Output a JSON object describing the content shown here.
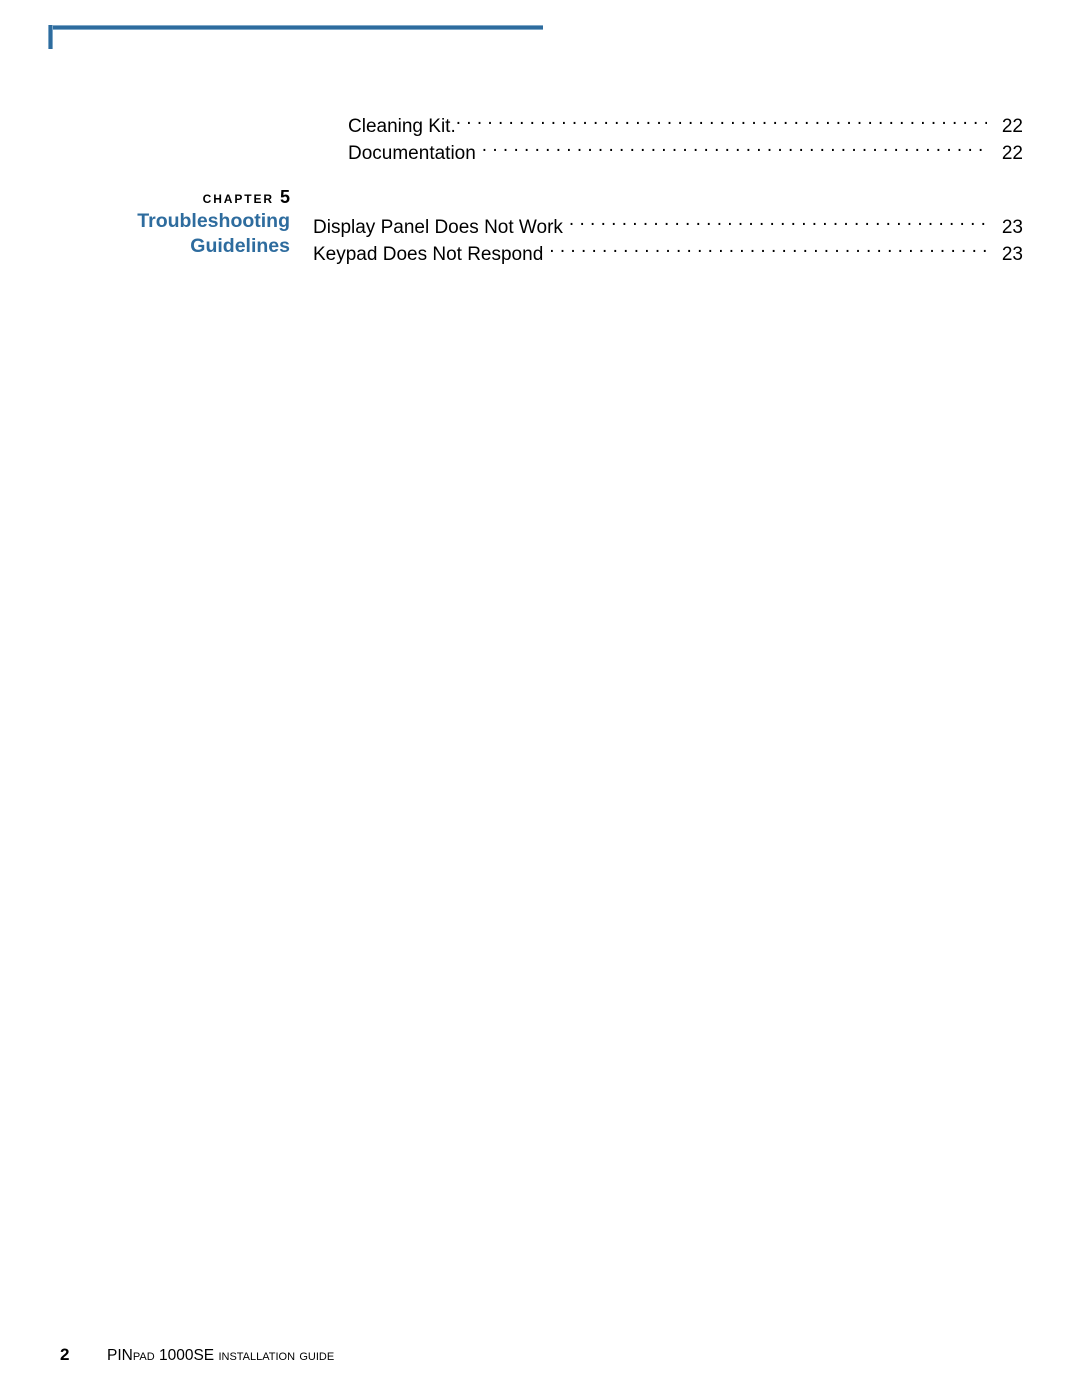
{
  "page": {
    "background_color": "#ffffff",
    "rule_color": "#2E6C9E",
    "accent_color": "#2E6C9E"
  },
  "chapter": {
    "kicker_label": "Chapter",
    "number": "5",
    "title_line_1": "Troubleshooting",
    "title_line_2": "Guidelines"
  },
  "toc": {
    "groups": [
      {
        "entries": [
          {
            "title": "Cleaning Kit.",
            "page": "22"
          },
          {
            "title": "Documentation",
            "page": "22"
          }
        ]
      },
      {
        "entries": [
          {
            "title": "Display Panel Does Not Work",
            "page": "23"
          },
          {
            "title": "Keypad Does Not Respond",
            "page": "23"
          }
        ]
      }
    ]
  },
  "footer": {
    "page_number": "2",
    "doc_title_part_1": "PIN",
    "doc_title_part_2": "pad",
    "doc_title_part_3": " 1000SE ",
    "doc_title_part_4": "Installation Guide"
  }
}
